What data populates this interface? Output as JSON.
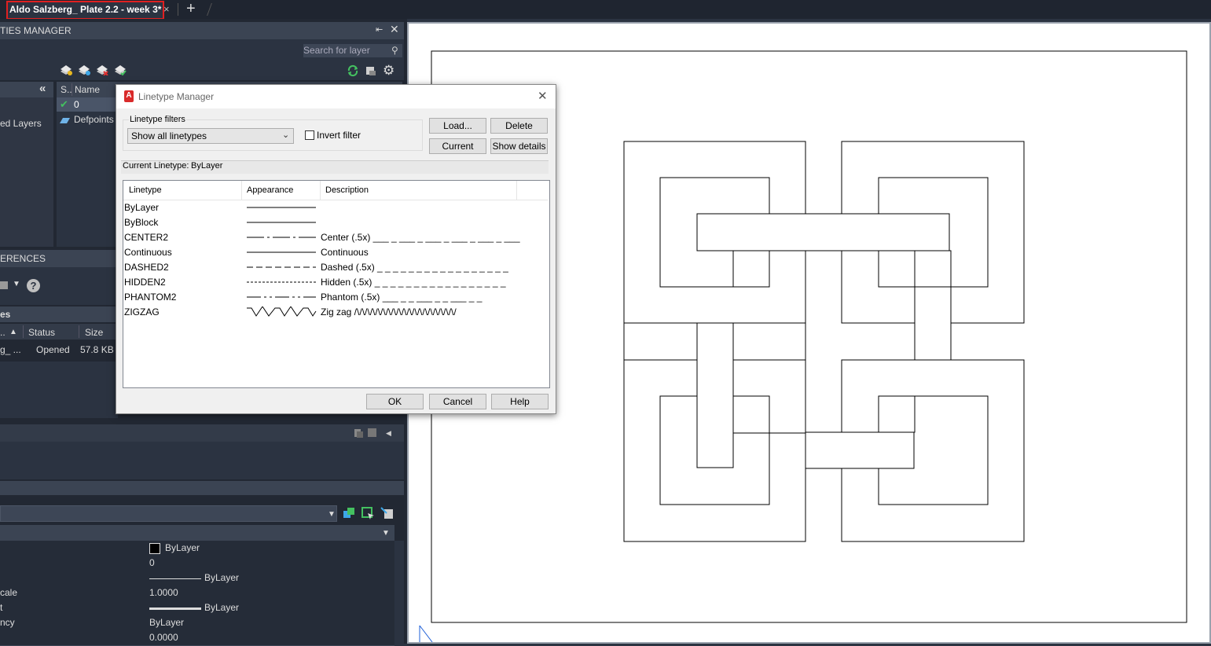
{
  "tabs": {
    "document": "Aldo Salzberg_ Plate 2.2 - week 3*",
    "close": "×",
    "new": "+"
  },
  "layer_panel": {
    "title": "TIES MANAGER",
    "search_placeholder": "Search for layer",
    "collapse": "«",
    "col_status": "S..",
    "col_name": "Name",
    "tree_item": "ed Layers",
    "layers": [
      {
        "name": "0"
      },
      {
        "name": "Defpoints"
      }
    ]
  },
  "xref_panel": {
    "title": "ERENCES",
    "help": "?",
    "files_title": "es",
    "col_name": "..",
    "col_status": "Status",
    "col_size": "Size",
    "file": {
      "name": "g_ ...",
      "status": "Opened",
      "size": "57.8 KB"
    }
  },
  "properties": {
    "rows": [
      {
        "label": "",
        "value": "ByLayer"
      },
      {
        "label": "",
        "value": "0"
      },
      {
        "label": "",
        "value": "ByLayer"
      },
      {
        "label": "cale",
        "value": "1.0000"
      },
      {
        "label": "t",
        "value": "ByLayer"
      },
      {
        "label": "ncy",
        "value": "ByLayer"
      },
      {
        "label": "",
        "value": "0.0000"
      }
    ]
  },
  "dialog": {
    "title": "Linetype Manager",
    "filters_label": "Linetype filters",
    "filter_value": "Show all linetypes",
    "invert_filter": "Invert filter",
    "current_linetype_label": "Current Linetype:",
    "current_linetype_value": "ByLayer",
    "buttons": {
      "load": "Load...",
      "delete": "Delete",
      "current": "Current",
      "show_details": "Show details",
      "ok": "OK",
      "cancel": "Cancel",
      "help": "Help"
    },
    "columns": {
      "linetype": "Linetype",
      "appearance": "Appearance",
      "description": "Description"
    },
    "linetypes": [
      {
        "name": "ByLayer",
        "pattern": "solid",
        "description": ""
      },
      {
        "name": "ByBlock",
        "pattern": "solid",
        "description": ""
      },
      {
        "name": "CENTER2",
        "pattern": "center",
        "description": "Center (.5x) ___ _ ___ _ ___ _ ___ _ ___ _ ___"
      },
      {
        "name": "Continuous",
        "pattern": "solid",
        "description": "Continuous"
      },
      {
        "name": "DASHED2",
        "pattern": "dashed",
        "description": "Dashed (.5x) _ _ _ _ _ _ _ _ _ _ _ _ _ _ _ _ _"
      },
      {
        "name": "HIDDEN2",
        "pattern": "hidden",
        "description": "Hidden (.5x) _ _ _ _ _ _ _ _ _ _ _ _ _ _ _ _ _"
      },
      {
        "name": "PHANTOM2",
        "pattern": "phantom",
        "description": "Phantom (.5x) ___ _ _ ___ _ _ ___ _ _"
      },
      {
        "name": "ZIGZAG",
        "pattern": "zigzag",
        "description": "Zig zag /\\/\\/\\/\\/\\/\\/\\/\\/\\/\\/\\/\\/\\/\\/\\/\\/\\/\\/\\/"
      }
    ]
  },
  "colors": {
    "accent_red": "#e02020",
    "check_green": "#44c060",
    "panel": "#2b3341"
  }
}
